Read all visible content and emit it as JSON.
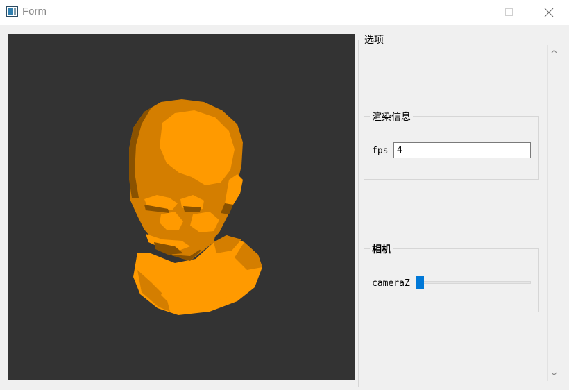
{
  "window": {
    "title": "Form"
  },
  "viewport": {
    "model": "3d-head-render"
  },
  "options": {
    "title": "选项",
    "render_info": {
      "title": "渲染信息",
      "fps_label": "fps",
      "fps_value": "4"
    },
    "camera": {
      "title": "相机",
      "cameraz_label": "cameraZ",
      "cameraz_value": 0
    }
  },
  "colors": {
    "viewport_bg": "#333333",
    "model_light": "#ff9a00",
    "model_mid": "#d47e00",
    "model_dark": "#8a5200",
    "slider_accent": "#0078d7"
  }
}
